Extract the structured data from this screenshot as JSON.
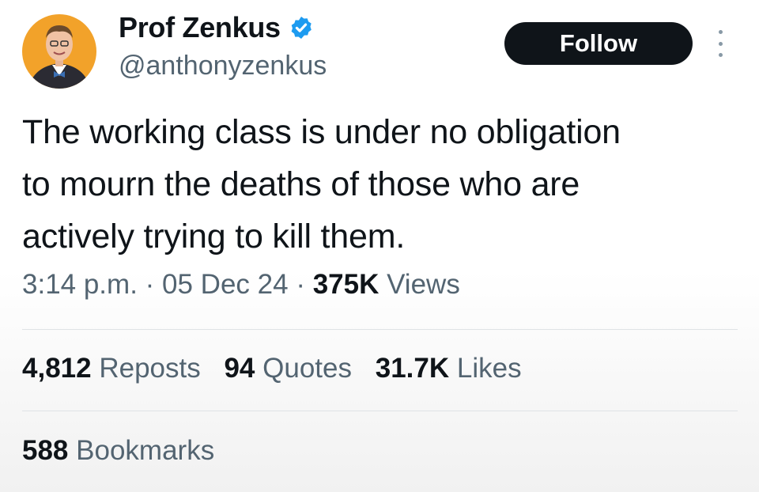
{
  "author": {
    "name": "Prof Zenkus",
    "handle": "@anthonyzenkus",
    "verified_icon": "verified-badge-icon",
    "avatar_icon": "avatar"
  },
  "follow_label": "Follow",
  "more_icon": "more-options-icon",
  "tweet": {
    "lines": [
      "The working class is under no obligation",
      "to mourn the deaths of those who are",
      "actively trying to kill them."
    ]
  },
  "meta": {
    "time": "3:14 p.m.",
    "sep1": " · ",
    "date": "05 Dec 24",
    "sep2": " · ",
    "views_count": "375K",
    "views_label": " Views"
  },
  "stats": {
    "reposts_count": "4,812",
    "reposts_label": "Reposts",
    "quotes_count": "94",
    "quotes_label": "Quotes",
    "likes_count": "31.7K",
    "likes_label": "Likes",
    "bookmarks_count": "588",
    "bookmarks_label": "Bookmarks"
  },
  "colors": {
    "text_primary": "#0f1419",
    "text_secondary": "#536471",
    "verified_blue": "#1d9bf0",
    "avatar_bg": "#f2a22a",
    "follow_bg": "#0f1419"
  }
}
